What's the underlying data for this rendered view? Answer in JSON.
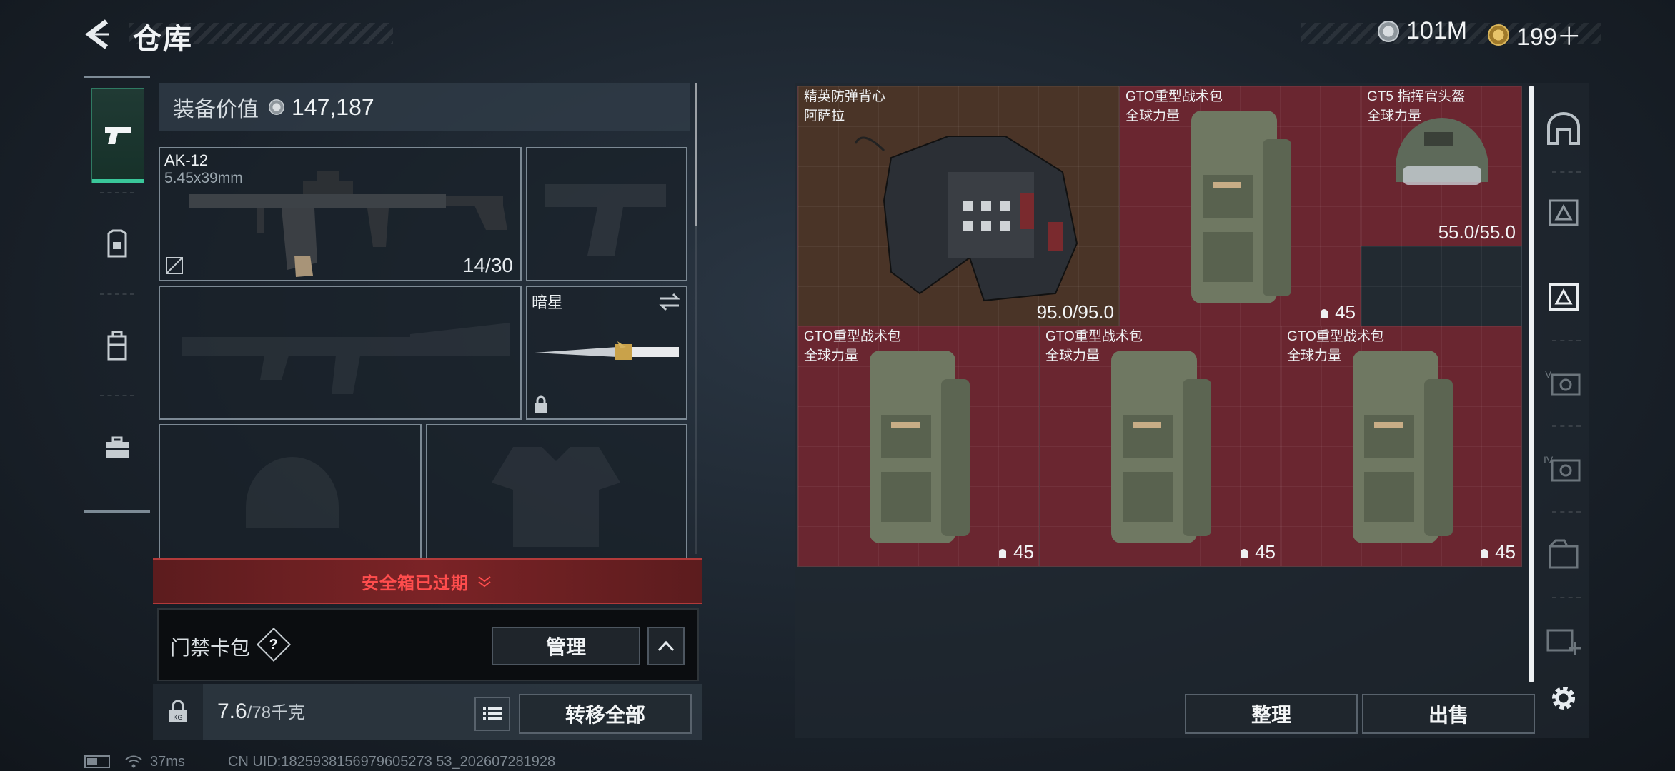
{
  "header": {
    "title": "仓库",
    "currency_primary": "101M",
    "currency_secondary": "199＋"
  },
  "left_rail": [
    {
      "name": "weapons",
      "icon": "pistol-icon",
      "active": true
    },
    {
      "name": "gear",
      "icon": "armor-icon",
      "active": false
    },
    {
      "name": "bag",
      "icon": "backpack-icon",
      "active": false
    },
    {
      "name": "case",
      "icon": "briefcase-icon",
      "active": false
    }
  ],
  "loadout": {
    "value_label": "装备价值",
    "value": "147,187",
    "primary": {
      "name": "AK-12",
      "ammo_type": "5.45x39mm",
      "ammo": "14/30"
    },
    "melee": {
      "name": "暗星"
    }
  },
  "safe_box": {
    "text": "安全箱已过期"
  },
  "keycard": {
    "label": "门禁卡包",
    "help": "?",
    "manage": "管理"
  },
  "capacity": {
    "current": "7.6",
    "max": "/78千克"
  },
  "actions": {
    "transfer_all": "转移全部",
    "sort": "整理",
    "sell": "出售"
  },
  "storage": [
    {
      "id": "vest",
      "name": "精英防弹背心",
      "sub": "阿萨拉",
      "value": "95.0/95.0"
    },
    {
      "id": "bag1",
      "name": "GTO重型战术包",
      "sub": "全球力量",
      "value": "45"
    },
    {
      "id": "helmet",
      "name": "GT5 指挥官头盔",
      "sub": "全球力量",
      "value": "55.0/55.0"
    },
    {
      "id": "bag2",
      "name": "GTO重型战术包",
      "sub": "全球力量",
      "value": "45"
    },
    {
      "id": "bag3",
      "name": "GTO重型战术包",
      "sub": "全球力量",
      "value": "45"
    },
    {
      "id": "bag4",
      "name": "GTO重型战术包",
      "sub": "全球力量",
      "value": "45"
    }
  ],
  "right_rail_icons": [
    "safehouse-icon",
    "level3-container-icon",
    "level3-active-container-icon",
    "level5-container-icon",
    "level4-container-icon",
    "folder-container-icon",
    "add-container-icon",
    "settings-gear-icon"
  ],
  "status": {
    "ping": "37ms",
    "uid": "CN UID:1825938156979605273 53_202607281928"
  },
  "colors": {
    "accent": "#3ac79a",
    "alert": "#ff4d4d",
    "rarity_red": "#6a2630",
    "rarity_brown": "#4a3427"
  }
}
